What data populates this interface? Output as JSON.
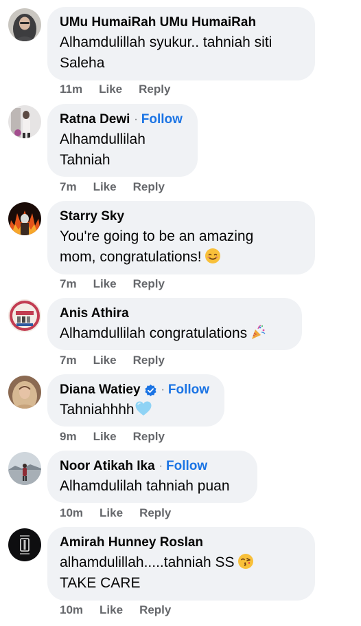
{
  "comments": [
    {
      "author": "UMu HumaiRah UMu HumaiRah",
      "follow": "",
      "text": "Alhamdulillah syukur.. tahniah siti\nSaleha",
      "time": "11m",
      "like": "Like",
      "reply": "Reply",
      "avatar_icon": "profile-photo-hijab-woman"
    },
    {
      "author": "Ratna Dewi",
      "follow": "Follow",
      "text": "Alhamdullilah\nTahniah",
      "time": "7m",
      "like": "Like",
      "reply": "Reply",
      "avatar_icon": "profile-photo-mirror-selfie"
    },
    {
      "author": "Starry Sky",
      "follow": "",
      "text": "You're going to be an amazing\nmom, congratulations!",
      "emoji": "smiling-face-emoji",
      "time": "7m",
      "like": "Like",
      "reply": "Reply",
      "avatar_icon": "profile-photo-fire-figure"
    },
    {
      "author": "Anis Athira",
      "follow": "",
      "text": "Alhamdullilah congratulations",
      "emoji": "party-popper-emoji",
      "time": "7m",
      "like": "Like",
      "reply": "Reply",
      "avatar_icon": "profile-photo-family-banner"
    },
    {
      "author": "Diana Watiey",
      "follow": "Follow",
      "verified": true,
      "text": "Tahniahhhh",
      "emoji": "light-blue-heart-emoji",
      "time": "9m",
      "like": "Like",
      "reply": "Reply",
      "avatar_icon": "profile-photo-hijab-portrait"
    },
    {
      "author": "Noor Atikah Ika",
      "follow": "Follow",
      "text": "Alhamdulilah tahniah puan",
      "time": "10m",
      "like": "Like",
      "reply": "Reply",
      "avatar_icon": "profile-photo-landscape-person"
    },
    {
      "author": "Amirah Hunney Roslan",
      "follow": "",
      "text": "alhamdulillah.....tahniah SS\nTAKE CARE",
      "emoji": "face-blowing-kiss-emoji",
      "time": "10m",
      "like": "Like",
      "reply": "Reply",
      "avatar_icon": "profile-photo-dark-logo"
    }
  ],
  "colors": {
    "bubble": "#f0f2f5",
    "follow": "#1b74e4",
    "meta": "#65676b",
    "verified": "#1b74e4"
  }
}
